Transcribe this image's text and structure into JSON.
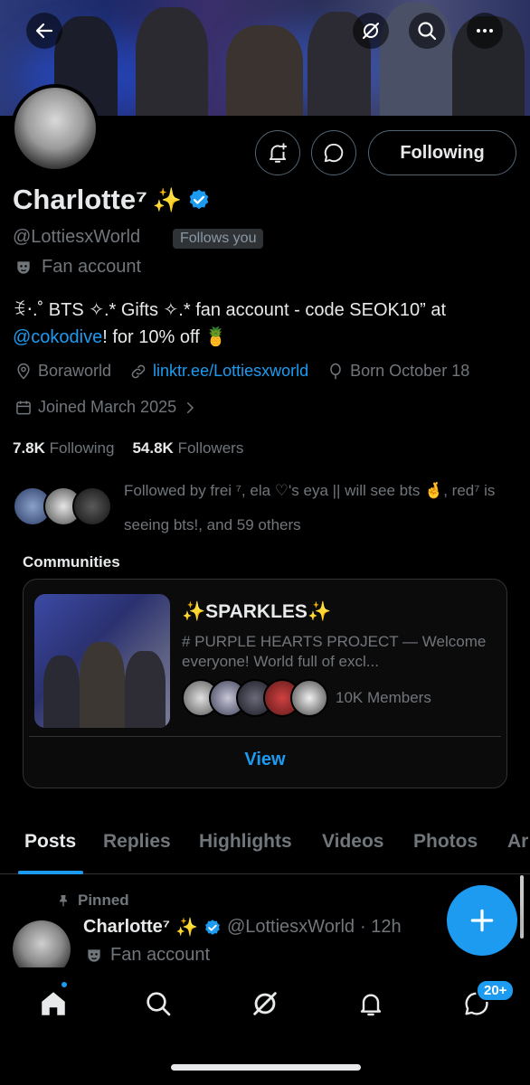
{
  "header": {
    "back_icon": "arrow-left-icon",
    "grok_icon": "grok-slash-icon",
    "search_icon": "search-icon",
    "more_icon": "more-horizontal-icon"
  },
  "profile": {
    "name": "Charlotte⁷",
    "name_emoji": "✨",
    "handle": "@LottiesxWorld",
    "follows_you": "Follows you",
    "category": "Fan account",
    "following_button": "Following",
    "bio_part1": "ꉂ‧.˚ BTS ✧.* Gifts ✧.* fan account - code SEOK10” at ",
    "bio_mention": "@cokodive",
    "bio_part2": "! for 10% off 🍍",
    "location": "Boraworld",
    "website": "linktr.ee/Lottiesxworld",
    "born": "Born October 18",
    "joined": "Joined March 2025",
    "following_count": "7.8K",
    "following_label": "Following",
    "followers_count": "54.8K",
    "followers_label": "Followers",
    "followed_by": "Followed by frei ⁷, ela ♡'s eya || will see bts 🤞, red⁷ is seeing bts!, and 59 others"
  },
  "communities": {
    "title": "Communities",
    "name": "✨SPARKLES✨",
    "description": "# PURPLE HEARTS PROJECT — Welcome everyone! World full of excl...",
    "members": "10K Members",
    "view_button": "View"
  },
  "tabs": [
    "Posts",
    "Replies",
    "Highlights",
    "Videos",
    "Photos",
    "Ar"
  ],
  "pinned_post": {
    "pinned_label": "Pinned",
    "name": "Charlotte⁷",
    "emoji": "✨",
    "handle": "@LottiesxWorld",
    "time": "· 12h",
    "category": "Fan account"
  },
  "bottom_nav": {
    "items": [
      "home-icon",
      "search-icon",
      "grok-icon",
      "notifications-icon",
      "messages-icon"
    ],
    "messages_badge": "20+"
  },
  "colors": {
    "accent": "#1d9bf0",
    "background": "#000000",
    "muted": "#71767b"
  }
}
